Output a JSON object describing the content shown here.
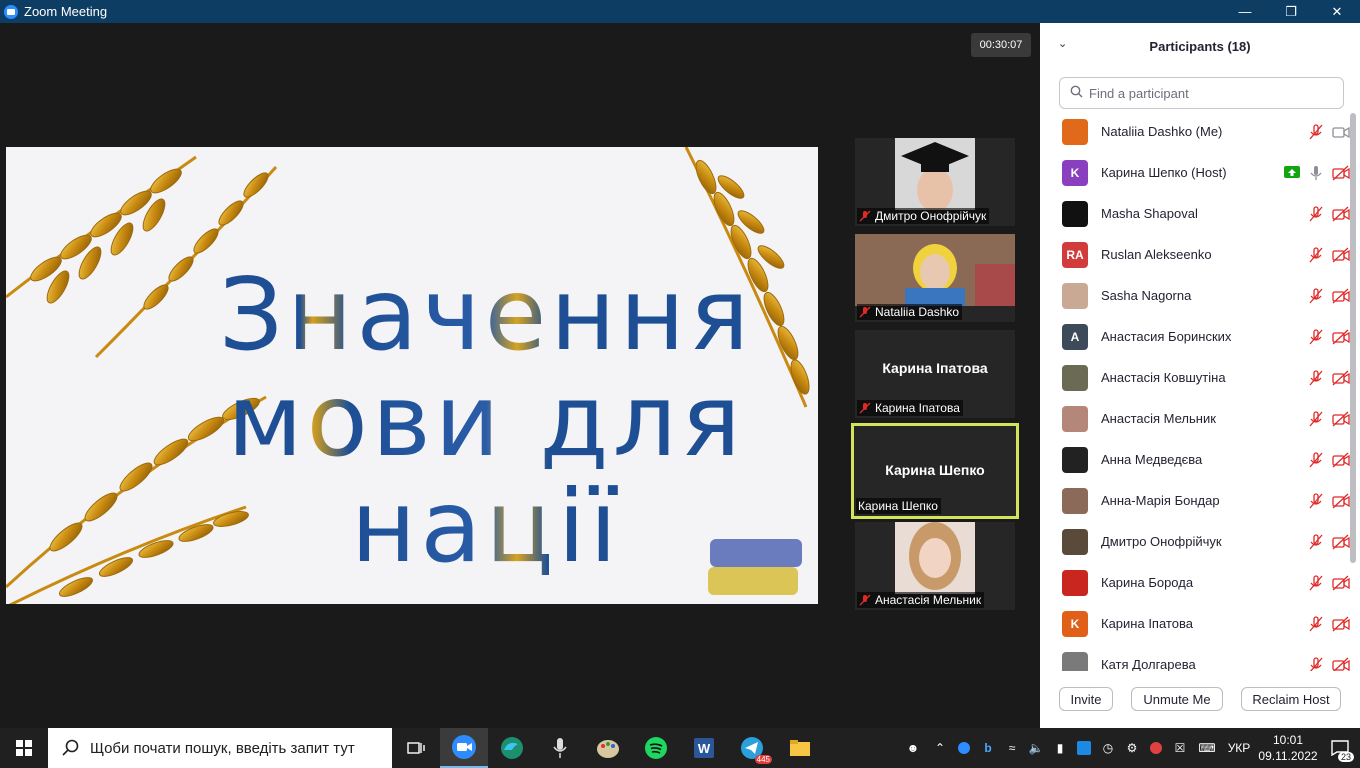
{
  "window": {
    "title": "Zoom Meeting",
    "timer": "00:30:07"
  },
  "slide": {
    "lines": [
      "Значення",
      "мови для",
      "нації"
    ]
  },
  "thumbnails": [
    {
      "name": "Дмитро Онофрійчук",
      "muted": true,
      "has_video": true
    },
    {
      "name": "Nataliia Dashko",
      "muted": true,
      "has_video": true
    },
    {
      "name": "Карина Іпатова",
      "muted": true,
      "has_video": false,
      "display_name": "Карина Іпатова"
    },
    {
      "name": "Карина Шепко",
      "muted": false,
      "has_video": false,
      "display_name": "Карина Шепко",
      "active_speaker": true
    },
    {
      "name": "Анастасія Мельник",
      "muted": true,
      "has_video": true
    }
  ],
  "participants_panel": {
    "title": "Participants (18)",
    "search_placeholder": "Find a participant",
    "participants": [
      {
        "name": "Nataliia Dashko (Me)",
        "avatar_color": "#e06a1a",
        "avatar_text": "",
        "audio": "muted",
        "video": "on"
      },
      {
        "name": "Карина Шепко (Host)",
        "avatar_color": "#8a3fbf",
        "avatar_text": "K",
        "audio": "unmuted",
        "video": "off",
        "share": true
      },
      {
        "name": "Masha Shapoval",
        "avatar_color": "#111111",
        "avatar_text": "",
        "audio": "muted",
        "video": "off"
      },
      {
        "name": "Ruslan Alekseenko",
        "avatar_color": "#d23b3b",
        "avatar_text": "RA",
        "audio": "muted",
        "video": "off"
      },
      {
        "name": "Sasha Nagorna",
        "avatar_color": "#c9a894",
        "avatar_text": "",
        "audio": "muted",
        "video": "off"
      },
      {
        "name": "Анастасия Боринских",
        "avatar_color": "#3d4a5a",
        "avatar_text": "A",
        "audio": "muted",
        "video": "off"
      },
      {
        "name": "Анастасія Ковшутіна",
        "avatar_color": "#6b6b55",
        "avatar_text": "",
        "audio": "muted",
        "video": "off"
      },
      {
        "name": "Анастасія Мельник",
        "avatar_color": "#b5877a",
        "avatar_text": "",
        "audio": "muted",
        "video": "off"
      },
      {
        "name": "Анна Медведєва",
        "avatar_color": "#222222",
        "avatar_text": "",
        "audio": "muted",
        "video": "off"
      },
      {
        "name": "Анна-Марія Бондар",
        "avatar_color": "#8c6a5a",
        "avatar_text": "",
        "audio": "muted",
        "video": "off"
      },
      {
        "name": "Дмитро Онофрійчук",
        "avatar_color": "#5a4a3a",
        "avatar_text": "",
        "audio": "muted",
        "video": "off"
      },
      {
        "name": "Карина Борода",
        "avatar_color": "#c8261e",
        "avatar_text": "",
        "audio": "muted",
        "video": "off"
      },
      {
        "name": "Карина Іпатова",
        "avatar_color": "#e0601a",
        "avatar_text": "K",
        "audio": "muted",
        "video": "off"
      },
      {
        "name": "Катя Долгарева",
        "avatar_color": "#7a7a7a",
        "avatar_text": "",
        "audio": "muted",
        "video": "off"
      }
    ],
    "buttons": {
      "invite": "Invite",
      "unmute": "Unmute Me",
      "reclaim": "Reclaim Host"
    }
  },
  "taskbar": {
    "search_placeholder": "Щоби почати пошук, введіть запит тут",
    "telegram_badge": "445",
    "language": "УКР",
    "time": "10:01",
    "date": "09.11.2022",
    "notifications": "23"
  }
}
